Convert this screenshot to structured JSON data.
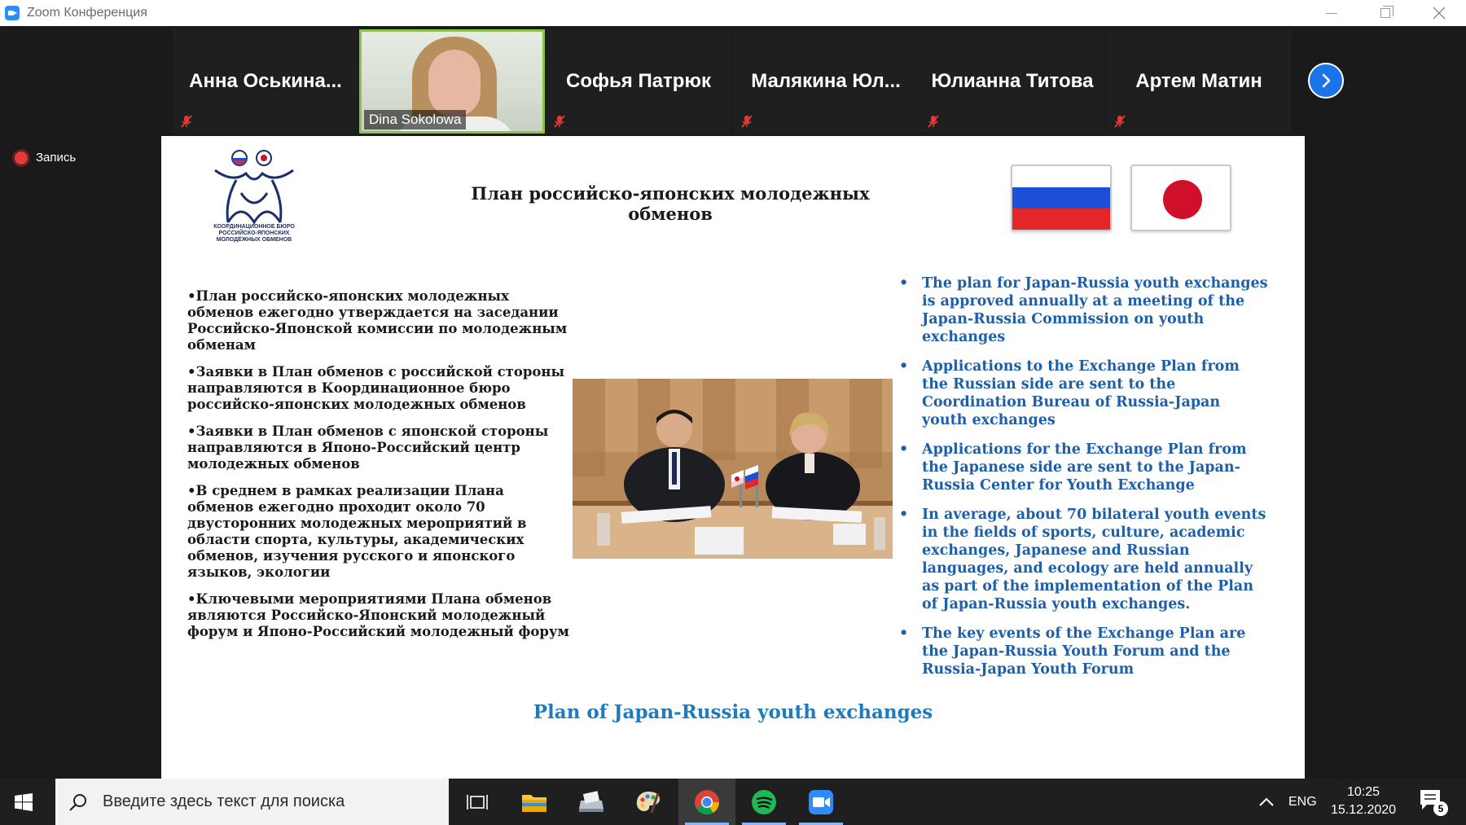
{
  "window": {
    "title": "Zoom Конференция"
  },
  "participants": [
    {
      "name": "Анна  Оськина..."
    },
    {
      "name": "Dina Sokolowa",
      "video": true
    },
    {
      "name": "Софья Патрюк"
    },
    {
      "name": "Малякина  Юл..."
    },
    {
      "name": "Юлианна Титова"
    },
    {
      "name": "Артем Матин"
    }
  ],
  "recording": {
    "label": "Запись"
  },
  "slide": {
    "logo_text": "КООРДИНАЦИОННОЕ БЮРО РОССИЙСКО-ЯПОНСКИХ МОЛОДЁЖНЫХ ОБМЕНОВ",
    "title": "План российско-японских молодежных обменов",
    "ru_points": [
      "•План российско-японских молодежных обменов ежегодно утверждается на заседании Российско-Японской комиссии по молодежным обменам",
      "•Заявки в План обменов с российской стороны направляются в Координационное бюро российско-японских молодежных обменов",
      "•Заявки в План обменов с японской стороны направляются в Японо-Российский центр молодежных обменов",
      "•В среднем в рамках реализации Плана обменов ежегодно проходит около 70 двусторонних молодежных мероприятий в области спорта, культуры, академических обменов, изучения русского и японского языков, экологии",
      "•Ключевыми мероприятиями Плана обменов являются Российско-Японский молодежный форум и Японо-Российский молодежный форум"
    ],
    "en_points": [
      "The plan for Japan-Russia youth exchanges is approved annually at a meeting of the Japan-Russia Commission on youth exchanges",
      "Applications to the Exchange Plan from the Russian side are sent to the Coordination Bureau of Russia-Japan youth exchanges",
      "Applications for the Exchange Plan from the Japanese side are sent to the Japan-Russia Center for Youth Exchange",
      "In average, about 70 bilateral youth events in the fields of sports, culture, academic exchanges, Japanese and Russian languages, and ecology are held annually as part of the implementation of the Plan of Japan-Russia youth exchanges.",
      "The key events of the Exchange Plan are the Japan-Russia Youth Forum and the Russia-Japan Youth Forum"
    ],
    "footer": "Plan of Japan-Russia youth exchanges"
  },
  "taskbar": {
    "search_placeholder": "Введите здесь текст для поиска",
    "language": "ENG",
    "time": "10:25",
    "date": "15.12.2020",
    "notifications": "5"
  },
  "colors": {
    "accent_blue": "#1f5fa8",
    "footer_blue": "#1f7bbd",
    "active_speaker_border": "#8bc34a",
    "next_button": "#1a73e8",
    "record_red": "#e53935"
  }
}
